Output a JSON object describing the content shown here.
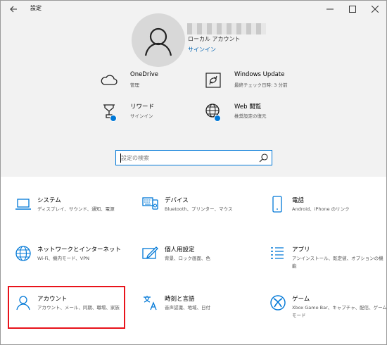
{
  "window": {
    "title": "設定",
    "back_icon": "arrow-left-icon",
    "controls": [
      "minimize",
      "maximize",
      "close"
    ]
  },
  "account": {
    "type": "ローカル アカウント",
    "signin": "サインイン"
  },
  "services": [
    {
      "name": "OneDrive",
      "sub": "管理",
      "icon": "cloud-icon"
    },
    {
      "name": "Windows Update",
      "sub": "最終チェック日時: 3 分前",
      "icon": "refresh-icon"
    },
    {
      "name": "リワード",
      "sub": "サインイン",
      "icon": "trophy-icon"
    },
    {
      "name": "Web 閲覧",
      "sub": "推奨設定の復元",
      "icon": "globe-icon"
    }
  ],
  "search": {
    "placeholder": "設定の検索"
  },
  "categories": [
    {
      "name": "システム",
      "desc": "ディスプレイ、サウンド、通知、電源",
      "icon": "laptop-icon"
    },
    {
      "name": "デバイス",
      "desc": "Bluetooth、プリンター、マウス",
      "icon": "devices-icon"
    },
    {
      "name": "電話",
      "desc": "Android、iPhone のリンク",
      "icon": "phone-icon"
    },
    {
      "name": "ネットワークとインターネット",
      "desc": "Wi-Fi、機内モード、VPN",
      "icon": "globe-icon"
    },
    {
      "name": "個人用設定",
      "desc": "背景、ロック画面、色",
      "icon": "paint-icon"
    },
    {
      "name": "アプリ",
      "desc": "アンインストール、既定値、オプションの機能",
      "icon": "apps-list-icon"
    },
    {
      "name": "アカウント",
      "desc": "アカウント、メール、同期、職場、家族",
      "icon": "person-icon"
    },
    {
      "name": "時刻と言語",
      "desc": "音声認識、地域、日付",
      "icon": "time-language-icon"
    },
    {
      "name": "ゲーム",
      "desc": "Xbox Game Bar、キャプチャ、配信、ゲーム モード",
      "icon": "xbox-icon"
    }
  ],
  "colors": {
    "accent": "#0078d7",
    "link": "#0063b1",
    "highlight": "#e8131b",
    "header_bg": "#f2f2f2"
  }
}
